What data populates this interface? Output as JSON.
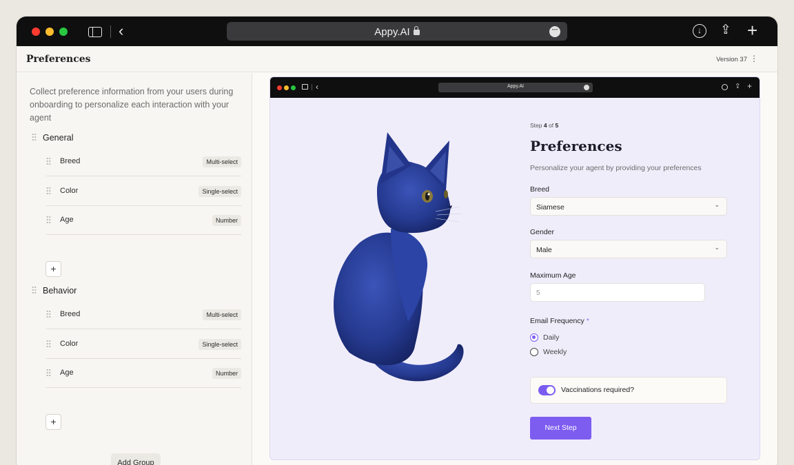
{
  "browser": {
    "url": "Appy.AI"
  },
  "app": {
    "title": "Preferences",
    "version": "Version 37"
  },
  "builder": {
    "intro": "Collect preference information from your users during onboarding to  personalize each interaction with your agent",
    "groups": [
      {
        "name": "General",
        "fields": [
          {
            "name": "Breed",
            "type": "Multi-select"
          },
          {
            "name": "Color",
            "type": "Single-select"
          },
          {
            "name": "Age",
            "type": "Number"
          }
        ]
      },
      {
        "name": "Behavior",
        "fields": [
          {
            "name": "Breed",
            "type": "Multi-select"
          },
          {
            "name": "Color",
            "type": "Single-select"
          },
          {
            "name": "Age",
            "type": "Number"
          }
        ]
      }
    ],
    "add_field_label": "+",
    "add_group_label": "Add Group"
  },
  "preview": {
    "url": "Appy.AI",
    "step_prefix": "Step",
    "step_current": "4",
    "step_of": "of",
    "step_total": "5",
    "title": "Preferences",
    "subtitle": "Personalize your agent by providing your preferences",
    "breed": {
      "label": "Breed",
      "value": "Siamese"
    },
    "gender": {
      "label": "Gender",
      "value": "Male"
    },
    "max_age": {
      "label": "Maximum Age",
      "placeholder": "5"
    },
    "email_frequency": {
      "label": "Email Frequency",
      "required_mark": "*",
      "options": [
        "Daily",
        "Weekly"
      ],
      "selected": "Daily"
    },
    "vaccinations": {
      "label": "Vaccinations required?",
      "enabled": true
    },
    "next_label": "Next Step"
  },
  "colors": {
    "accent": "#7d5cf0",
    "preview_bg": "#f0edfb",
    "titlebar": "#0f0f10"
  }
}
